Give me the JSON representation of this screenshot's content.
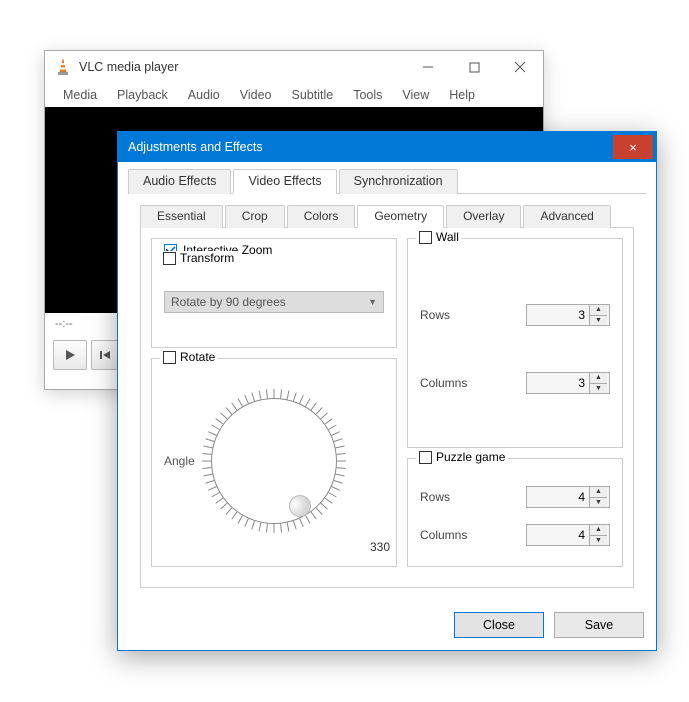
{
  "main_window": {
    "title": "VLC media player",
    "menus": [
      "Media",
      "Playback",
      "Audio",
      "Video",
      "Subtitle",
      "Tools",
      "View",
      "Help"
    ],
    "time_left": "--:--",
    "time_right": "--:--"
  },
  "dialog": {
    "title": "Adjustments and Effects",
    "close_glyph": "×",
    "top_tabs": [
      {
        "label": "Audio Effects",
        "active": false
      },
      {
        "label": "Video Effects",
        "active": true
      },
      {
        "label": "Synchronization",
        "active": false
      }
    ],
    "sub_tabs": [
      {
        "label": "Essential",
        "active": false
      },
      {
        "label": "Crop",
        "active": false
      },
      {
        "label": "Colors",
        "active": false
      },
      {
        "label": "Geometry",
        "active": true
      },
      {
        "label": "Overlay",
        "active": false
      },
      {
        "label": "Advanced",
        "active": false
      }
    ],
    "interactive_zoom": {
      "label": "Interactive Zoom",
      "checked": true
    },
    "transform": {
      "label": "Transform",
      "checked": false,
      "dropdown_value": "Rotate by 90 degrees"
    },
    "rotate": {
      "label": "Rotate",
      "checked": false,
      "angle_label": "Angle",
      "angle_value": "330"
    },
    "wall": {
      "label": "Wall",
      "checked": false,
      "rows_label": "Rows",
      "rows_value": "3",
      "cols_label": "Columns",
      "cols_value": "3"
    },
    "puzzle": {
      "label": "Puzzle game",
      "checked": false,
      "rows_label": "Rows",
      "rows_value": "4",
      "cols_label": "Columns",
      "cols_value": "4"
    },
    "buttons": {
      "close": "Close",
      "save": "Save"
    }
  }
}
